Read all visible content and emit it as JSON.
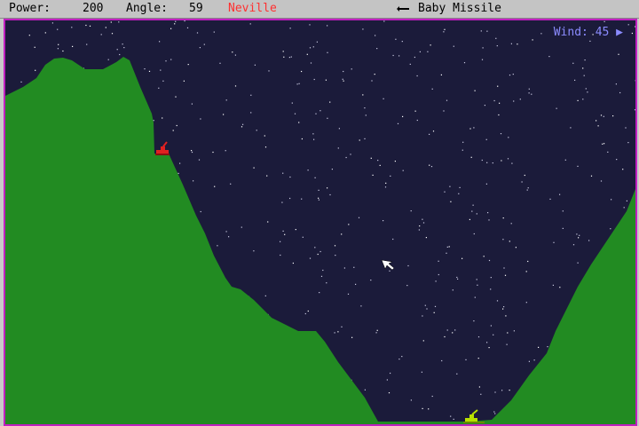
{
  "hud": {
    "power_label": "Power:",
    "power_value": "200",
    "angle_label": "Angle:",
    "angle_value": "59",
    "player_name": "Neville",
    "weapon_name": "Baby Missile"
  },
  "wind": {
    "label": "Wind:",
    "value": "45",
    "direction": "right"
  },
  "colors": {
    "sky": "#1b1b3a",
    "terrain": "#228b22",
    "border": "#c020c0",
    "active_player": "#ff3030",
    "tank_red": "#e02020",
    "tank_yellow": "#b8e000",
    "wind_text": "#8b8bff"
  },
  "icons": [
    "weapon-icon",
    "wind-arrow-icon",
    "cursor-icon"
  ]
}
